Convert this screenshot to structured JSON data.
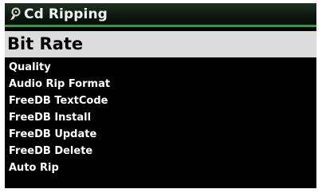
{
  "header": {
    "title": "Cd Ripping",
    "icon": "disc-player-icon"
  },
  "menu": {
    "selected_index": 0,
    "items": [
      {
        "label": "Bit Rate"
      },
      {
        "label": "Quality"
      },
      {
        "label": "Audio Rip Format"
      },
      {
        "label": "FreeDB TextCode"
      },
      {
        "label": "FreeDB Install"
      },
      {
        "label": "FreeDB Update"
      },
      {
        "label": "FreeDB Delete"
      },
      {
        "label": "Auto Rip"
      }
    ]
  },
  "colors": {
    "background": "#000000",
    "accent": "#2f9c3f",
    "selected_background": "#dcdcdc",
    "text": "#ffffff",
    "selected_text": "#000000"
  }
}
